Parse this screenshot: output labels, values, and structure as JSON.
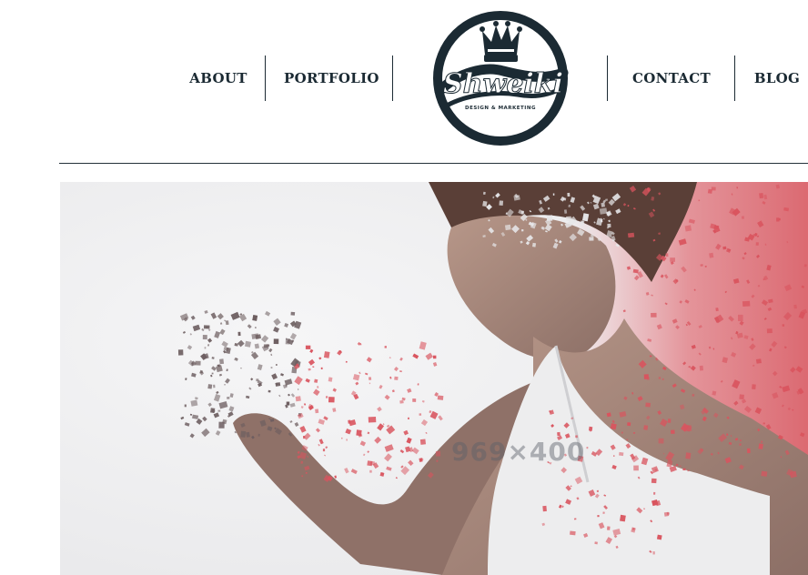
{
  "nav": {
    "about": "ABOUT",
    "portfolio": "PORTFOLIO",
    "contact": "CONTACT",
    "blog": "BLOG"
  },
  "logo": {
    "wordmark": "Shweiki",
    "tagline": "DESIGN & MARKETING"
  },
  "hero": {
    "placeholder_size": "969×400"
  },
  "colors": {
    "navy": "#1b2a33",
    "accent_red": "#d94a55",
    "background": "#ffffff"
  }
}
